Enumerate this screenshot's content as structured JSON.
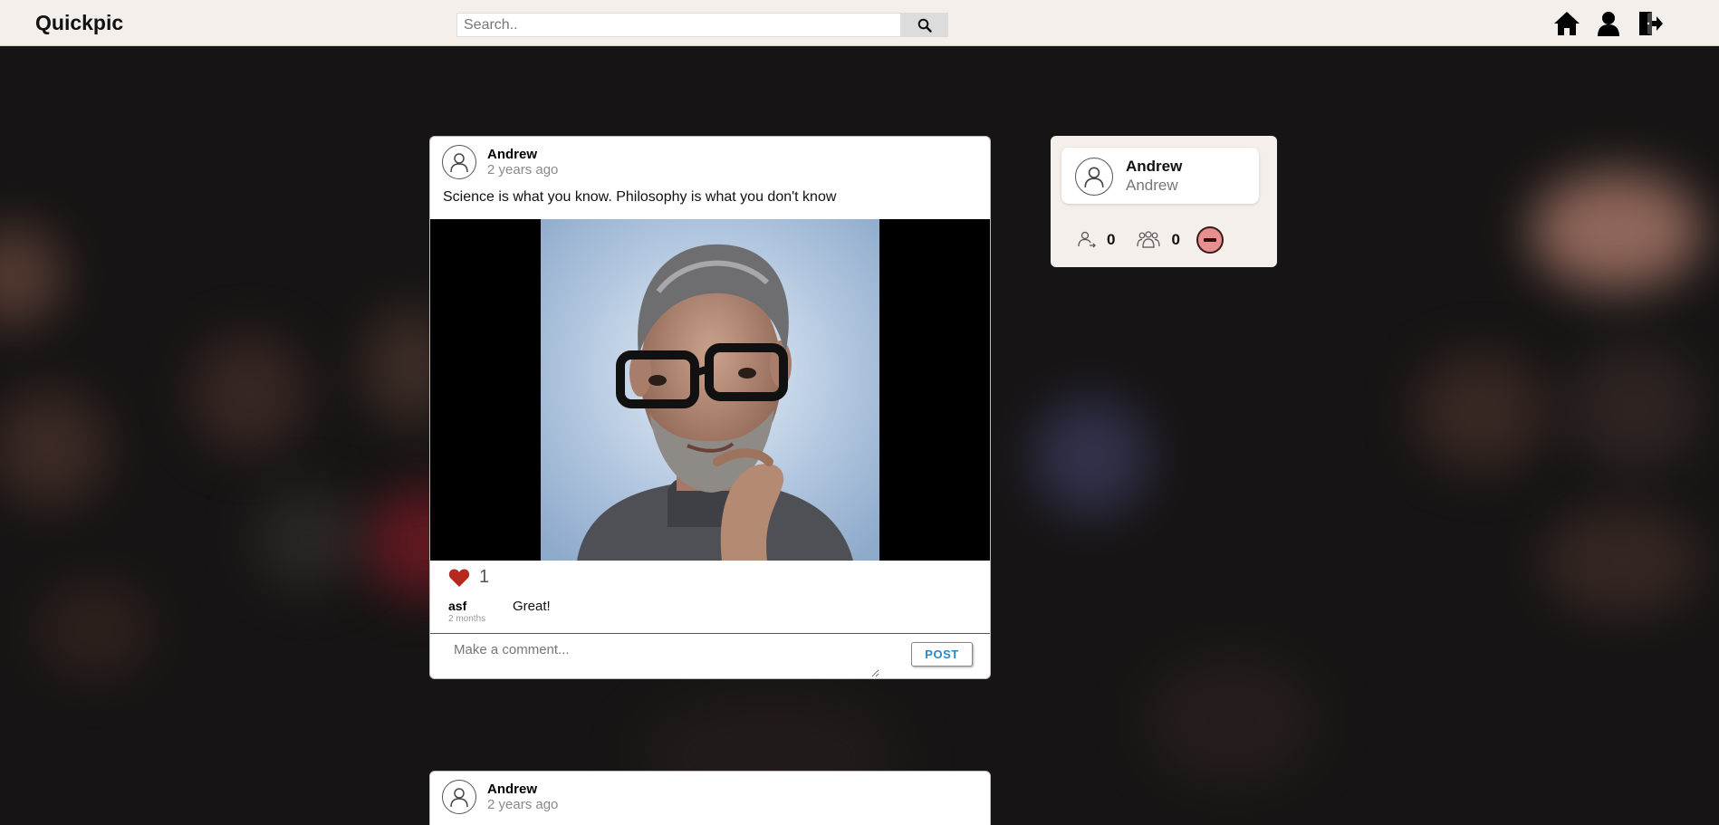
{
  "app": {
    "title": "Quickpic"
  },
  "search": {
    "placeholder": "Search.."
  },
  "nav": {
    "icons": [
      "search-icon",
      "home-icon",
      "user-icon",
      "logout-icon"
    ]
  },
  "posts": [
    {
      "author": "Andrew",
      "time": "2 years ago",
      "caption": "Science is what you know. Philosophy is what you don't know",
      "likes": "1",
      "comments": [
        {
          "user": "asf",
          "time": "2 months",
          "text": "Great!"
        }
      ],
      "comment_placeholder": "Make a comment...",
      "post_label": "POST"
    },
    {
      "author": "Andrew",
      "time": "2 years ago"
    }
  ],
  "profile": {
    "name": "Andrew",
    "username": "Andrew",
    "following": "0",
    "followers": "0"
  },
  "colors": {
    "navbar": "#f4efea",
    "background": "#161414",
    "like": "#b52a1e",
    "post_button_text": "#2a87c8",
    "unfollow": "#e89090"
  }
}
